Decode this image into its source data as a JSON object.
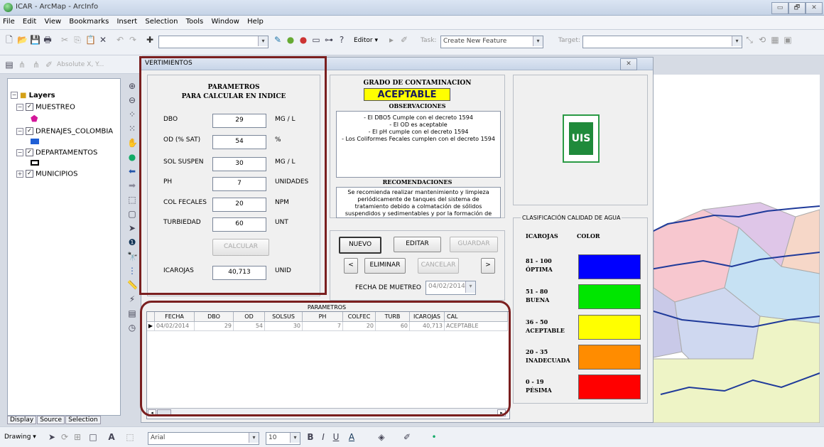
{
  "window": {
    "title": "ICAR - ArcMap - ArcInfo",
    "buttons": [
      "▭",
      "🗗",
      "✕"
    ]
  },
  "menu": [
    "File",
    "Edit",
    "View",
    "Bookmarks",
    "Insert",
    "Selection",
    "Tools",
    "Window",
    "Help"
  ],
  "toolbar": {
    "editor_label": "Editor ▾",
    "task_label": "Task:",
    "task_value": "Create New Feature",
    "target_label": "Target:",
    "absolute_label": "Absolute X, Y..."
  },
  "toc": {
    "root": "Layers",
    "layers": [
      {
        "name": "MUESTREO"
      },
      {
        "name": "DRENAJES_COLOMBIA"
      },
      {
        "name": "DEPARTAMENTOS"
      },
      {
        "name": "MUNICIPIOS"
      }
    ],
    "tabs": [
      "Display",
      "Source",
      "Selection"
    ]
  },
  "dialog": {
    "title": "VERTIMIENTOS",
    "params_title": "PARAMETROS",
    "params_subtitle": "PARA CALCULAR EN INDICE",
    "params": [
      {
        "label": "DBO",
        "value": "29",
        "unit": "MG / L"
      },
      {
        "label": "OD (% SAT)",
        "value": "54",
        "unit": "%"
      },
      {
        "label": "SOL SUSPEN",
        "value": "30",
        "unit": "MG / L"
      },
      {
        "label": "PH",
        "value": "7",
        "unit": "UNIDADES"
      },
      {
        "label": "COL FECALES",
        "value": "20",
        "unit": "NPM"
      },
      {
        "label": "TURBIEDAD",
        "value": "60",
        "unit": "UNT"
      }
    ],
    "calc_button": "CALCULAR",
    "icarojas_label": "ICAROJAS",
    "icarojas_value": "40,713",
    "icarojas_unit": "UNID",
    "grado_title": "GRADO DE CONTAMINACION",
    "grado_value": "ACEPTABLE",
    "observaciones_title": "OBSERVACIONES",
    "observaciones": [
      "- El DBO5 Cumple con el decreto 1594",
      "- El OD es aceptable",
      "- El pH cumple con el decreto 1594",
      "- Los Coliformes Fecales cumplen con el decreto 1594"
    ],
    "recomendaciones_title": "RECOMENDACIONES",
    "recomendaciones": [
      "Se recomienda realizar mantenimiento y limpieza",
      "periódicamente de tanques del sistema de",
      "tratamiento debido a colmatación de sólidos",
      "suspendidos y sedimentables y por la formación de"
    ],
    "buttons": {
      "nuevo": "NUEVO",
      "editar": "EDITAR",
      "guardar": "GUARDAR",
      "prev": "<",
      "eliminar": "ELIMINAR",
      "cancelar": "CANCELAR",
      "next": ">"
    },
    "fecha_label": "FECHA DE MUETREO",
    "fecha_value": "04/02/2014",
    "logo_text": "UIS",
    "clasificacion_title": "CLASIFICACIÓN CALIDAD DE AGUA",
    "clasificacion_headers": [
      "ICAROJAS",
      "COLOR"
    ],
    "clasificacion": [
      {
        "range": "81 - 100",
        "name": "ÓPTIMA",
        "color": "#0000ff"
      },
      {
        "range": "51 - 80",
        "name": "BUENA",
        "color": "#00e600"
      },
      {
        "range": "36 - 50",
        "name": "ACEPTABLE",
        "color": "#ffff00"
      },
      {
        "range": "20 - 35",
        "name": "INADECUADA",
        "color": "#ff8c00"
      },
      {
        "range": "0 - 19",
        "name": "PÉSIMA",
        "color": "#ff0000"
      }
    ],
    "grid_title": "PARAMETROS",
    "grid_headers": [
      "FECHA",
      "DBO",
      "OD",
      "SOLSUS",
      "PH",
      "COLFEC",
      "TURB",
      "ICAROJAS",
      "CAL"
    ],
    "grid_rows": [
      [
        "04/02/2014",
        "29",
        "54",
        "30",
        "7",
        "20",
        "60",
        "40,713",
        "ACEPTABLE"
      ]
    ]
  },
  "drawbar": {
    "drawing": "Drawing ▾",
    "font": "Arial",
    "size": "10"
  }
}
